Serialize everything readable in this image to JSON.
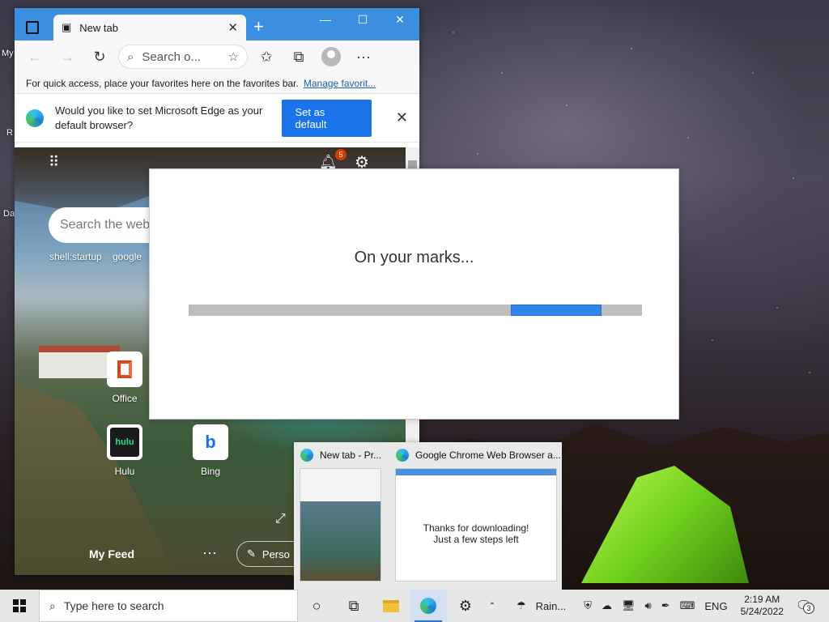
{
  "browser": {
    "tab_title": "New tab",
    "address_placeholder": "Search o...",
    "favbar_text": "For quick access, place your favorites here on the favorites bar.",
    "favbar_link": "Manage favorit...",
    "default_prompt": "Would you like to set Microsoft Edge as your default browser?",
    "default_button": "Set as default",
    "notification_count": "5",
    "ntp_search_placeholder": "Search the web",
    "quick_links": [
      "shell:startup",
      "google"
    ],
    "tiles": [
      {
        "label": "Office"
      },
      {
        "label": "Hulu",
        "glyph": "hulu"
      },
      {
        "label": "Bing"
      }
    ],
    "feed_label": "My Feed",
    "personalize_label": "Perso"
  },
  "desktop": {
    "icon_labels": [
      "My",
      "R",
      "Da"
    ]
  },
  "dialog": {
    "message": "On your marks...",
    "progress_segment_start": 0.71,
    "progress_segment_end": 0.91
  },
  "taskbar_preview": {
    "items": [
      {
        "title": "New tab - Pr..."
      },
      {
        "title": "Google Chrome Web Browser a...",
        "body_line1": "Thanks for downloading!",
        "body_line2": "Just a few steps left"
      }
    ]
  },
  "taskbar": {
    "search_placeholder": "Type here to search",
    "weather": "Rain...",
    "language": "ENG",
    "time": "2:19 AM",
    "date": "5/24/2022",
    "notification_count": "3"
  },
  "colors": {
    "accent": "#1a73e8",
    "titlebar": "#3c8fe0",
    "progress": "#2f86eb"
  }
}
